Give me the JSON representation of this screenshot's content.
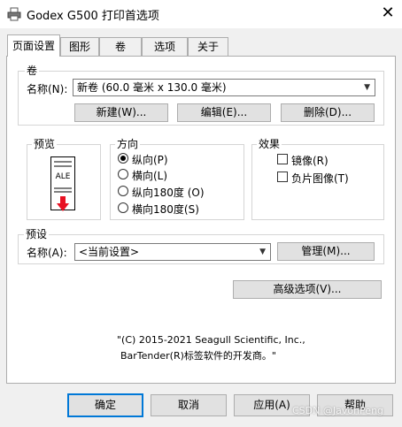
{
  "window": {
    "title": "Godex G500 打印首选项",
    "close_glyph": "✕",
    "app_icon": "printer-icon"
  },
  "tabs": [
    "页面设置",
    "图形",
    "卷",
    "选项",
    "关于"
  ],
  "stock": {
    "group_title": "卷",
    "name_label": "名称(N):",
    "name_value": "新卷 (60.0 毫米 x 130.0 毫米)",
    "new_button": "新建(W)...",
    "edit_button": "编辑(E)...",
    "delete_button": "删除(D)..."
  },
  "preview": {
    "group_title": "预览",
    "label_text": "ALE"
  },
  "orientation": {
    "group_title": "方向",
    "options": [
      "纵向(P)",
      "横向(L)",
      "纵向180度 (O)",
      "横向180度(S)"
    ],
    "selected_index": 0
  },
  "effects": {
    "group_title": "效果",
    "options": [
      "镜像(R)",
      "负片图像(T)"
    ]
  },
  "preset": {
    "group_title": "预设",
    "name_label": "名称(A):",
    "name_value": "<当前设置>",
    "manage_button": "管理(M)..."
  },
  "advanced_button": "高级选项(V)...",
  "copyright": [
    "\"(C) 2015-2021 Seagull Scientific, Inc.,",
    "BarTender(R)标签软件的开发商。\""
  ],
  "footer": {
    "ok_button": "确定",
    "cancel_button": "取消",
    "apply_button": "应用(A)",
    "help_button": "帮助",
    "watermark": "CSDN @JavonPeng"
  },
  "colors": {
    "accent": "#0078d7",
    "arrow": "#e81123"
  }
}
